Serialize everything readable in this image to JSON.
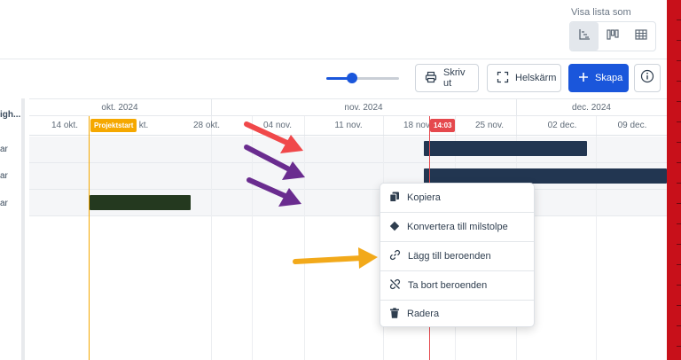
{
  "view_switcher": {
    "label": "Visa lista som",
    "options": [
      {
        "icon": "gantt-view-icon",
        "active": true
      },
      {
        "icon": "board-view-icon",
        "active": false
      },
      {
        "icon": "table-view-icon",
        "active": false
      }
    ]
  },
  "toolbar": {
    "zoom_level": 0.35,
    "print_label": "Skriv ut",
    "fullscreen_label": "Helskärm",
    "create_label": "Skapa",
    "accent_color": "#1a56db"
  },
  "timeline": {
    "months": [
      "okt. 2024",
      "nov. 2024",
      "dec. 2024"
    ],
    "weeks": [
      "14 okt.",
      "kt.",
      "28 okt.",
      "04 nov.",
      "11 nov.",
      "18 nov.",
      "25 nov.",
      "02 dec.",
      "09 dec."
    ],
    "project_start_label": "Projektstart",
    "project_start_color": "#f5a800",
    "now_label": "14:03",
    "now_color": "#e5484d"
  },
  "left_column": {
    "header": "igh...",
    "rows": [
      "ar",
      "ar",
      "ar"
    ]
  },
  "bars": {
    "navy_color": "#223651",
    "green_color": "#24391f"
  },
  "context_menu": {
    "items": [
      {
        "label": "Kopiera",
        "icon": "copy-icon"
      },
      {
        "label": "Konvertera till milstolpe",
        "icon": "diamond-icon"
      },
      {
        "label": "Lägg till beroenden",
        "icon": "link-icon"
      },
      {
        "label": "Ta bort beroenden",
        "icon": "unlink-icon"
      },
      {
        "label": "Radera",
        "icon": "trash-icon"
      }
    ]
  },
  "annotation_colors": {
    "red_arrow": "#f0484a",
    "purple_arrow": "#6a2c8f",
    "orange_arrow": "#f2a91a"
  }
}
